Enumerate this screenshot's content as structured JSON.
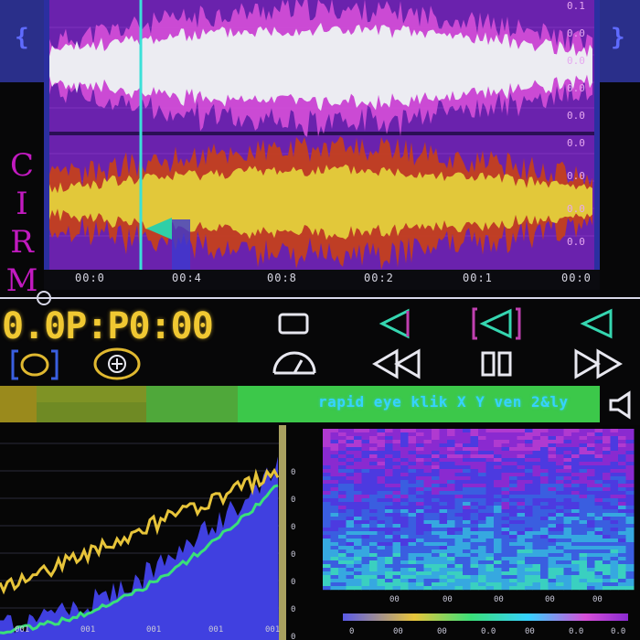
{
  "app": {
    "side_label_letters": [
      "C",
      "I",
      "R",
      "M"
    ],
    "left_chevron": "{",
    "right_chevron": "}"
  },
  "waveform": {
    "top_channel_color": "#e8e8ef",
    "top_envelope_color": "#d64fd8",
    "bottom_channel_color": "#e2c83a",
    "bottom_envelope_color": "#c4401e",
    "background_color": "#6b1fa8",
    "right_scale_top": [
      "0.1",
      "0.0",
      "0.0",
      "0.0",
      "0.0"
    ],
    "right_scale_bottom": [
      "0.0",
      "0.0",
      "0.0",
      "0.0"
    ]
  },
  "timeline": {
    "ticks": [
      "00:0",
      "00:4",
      "00:8",
      "00:2",
      "00:1",
      "00:0"
    ]
  },
  "transport": {
    "timecode": "0.0P:P0:00",
    "accent_color": "#f0c832",
    "icon_color": "#35d6b0"
  },
  "banner": {
    "title": "rapid eye klik X Y ven 2&ly",
    "colors": [
      "#9a8a1c",
      "#6f8a24",
      "#4fa83a",
      "#3cc84a"
    ]
  },
  "spectrum": {
    "x_ticks": [
      "001",
      "001",
      "001",
      "001",
      "001"
    ],
    "y_ticks": [
      "0",
      "0",
      "0",
      "0",
      "0",
      "0",
      "0"
    ],
    "colors": {
      "yellow": "#e7c43a",
      "green": "#3ae07a",
      "blue": "#4040e0"
    }
  },
  "spectrogram": {
    "bottom_ticks": [
      "00",
      "00",
      "00",
      "00",
      "00"
    ],
    "colorbar_ticks": [
      "0",
      "00",
      "00",
      "0.0",
      "00",
      "0.0",
      "0.0"
    ]
  }
}
